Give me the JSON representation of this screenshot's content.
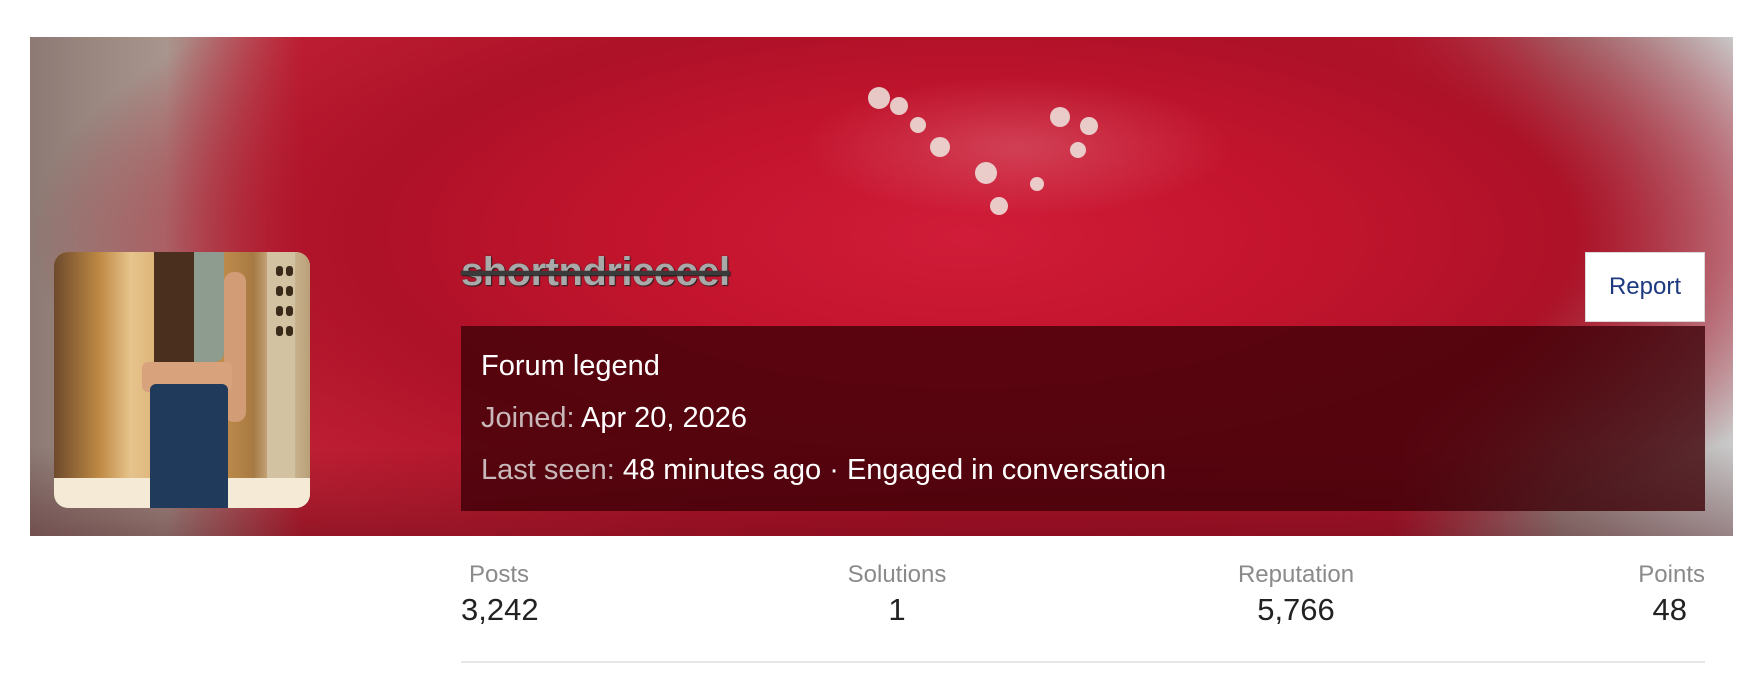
{
  "profile": {
    "username": "shortndricecel",
    "report_label": "Report",
    "title": "Forum legend",
    "joined_label": "Joined:",
    "joined_value": "Apr 20, 2026",
    "last_seen_label": "Last seen:",
    "last_seen_value": "48 minutes ago · Engaged in conversation"
  },
  "stats": {
    "posts": {
      "label": "Posts",
      "value": "3,242"
    },
    "solutions": {
      "label": "Solutions",
      "value": "1"
    },
    "reputation": {
      "label": "Reputation",
      "value": "5,766"
    },
    "points": {
      "label": "Points",
      "value": "48"
    }
  },
  "colors": {
    "banner_red": "#c41731",
    "report_text": "#1d3a80",
    "panel_bg": "#3c0006"
  }
}
